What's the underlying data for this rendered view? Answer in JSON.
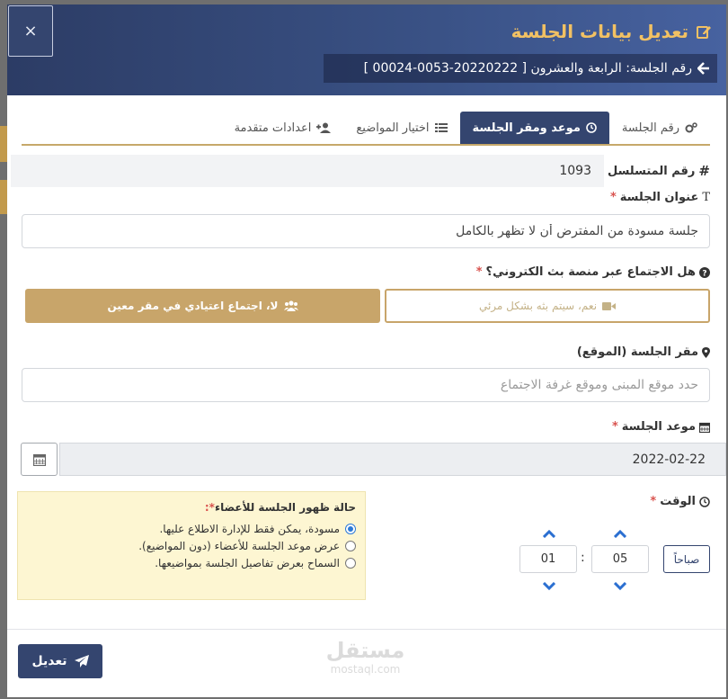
{
  "modal": {
    "title": "تعديل بيانات الجلسة",
    "close_label": "×",
    "subtitle": "رقم الجلسة: الرابعة والعشرون [ 20220222-0053-00024 ]"
  },
  "tabs": [
    {
      "label": "رقم الجلسة",
      "icon": "gears-icon",
      "active": false
    },
    {
      "label": "موعد ومقر الجلسة",
      "icon": "clock-icon",
      "active": true
    },
    {
      "label": "اختيار المواضيع",
      "icon": "list-icon",
      "active": false
    },
    {
      "label": "اعدادات متقدمة",
      "icon": "user-plus-icon",
      "active": false
    }
  ],
  "serial": {
    "label": "رقم المتسلسل",
    "value": "1093"
  },
  "session_title": {
    "label": "عنوان الجلسة",
    "required_mark": "*",
    "value": "جلسة مسودة من المفترض أن لا تظهر بالكامل"
  },
  "broadcast": {
    "label": "هل الاجتماع عبر منصة بث الكتروني؟",
    "required_mark": "*",
    "yes_label": "نعم، سيتم بثه بشكل مرئي",
    "no_label": "لا، اجتماع اعتيادي في مقر معين"
  },
  "location": {
    "label": "مقر الجلسة (الموقع)",
    "placeholder": "حدد موقع المبنى وموقع غرفة الاجتماع"
  },
  "date": {
    "label": "موعد الجلسة",
    "required_mark": "*",
    "value": "2022-02-22"
  },
  "visibility": {
    "title": "حالة ظهور الجلسة للأعضاء",
    "required_mark": "*:",
    "options": [
      {
        "label": "مسودة، يمكن فقط للإدارة الاطلاع عليها.",
        "checked": true
      },
      {
        "label": "عرض موعد الجلسة للأعضاء (دون المواضيع).",
        "checked": false
      },
      {
        "label": "السماح بعرض تفاصيل الجلسة بمواضيعها.",
        "checked": false
      }
    ]
  },
  "time": {
    "label": "الوقت",
    "required_mark": "*",
    "hours": "05",
    "minutes": "01",
    "separator": ":",
    "period": "صباحاً"
  },
  "submit_label": "تعديل",
  "watermark": {
    "arabic": "مستقل",
    "latin": "mostaql.com"
  },
  "colors": {
    "header": "#34456f",
    "accent": "#c8a56a",
    "title_gold": "#f2c163",
    "notice_bg": "#fdf6d2"
  }
}
